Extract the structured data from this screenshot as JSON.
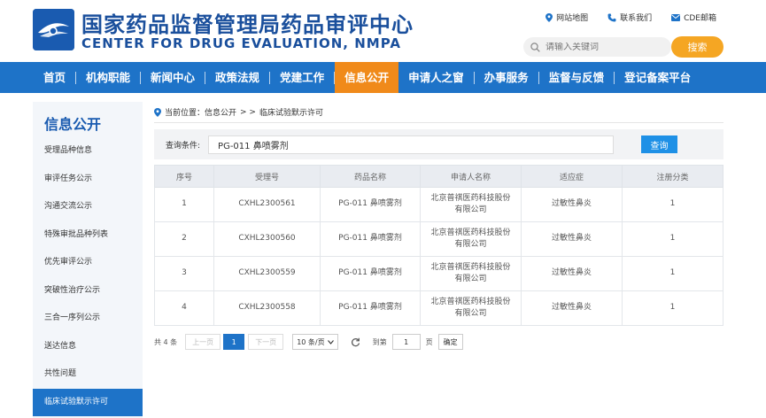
{
  "header": {
    "title_cn": "国家药品监督管理局药品审评中心",
    "title_en": "CENTER FOR DRUG EVALUATION, NMPA",
    "links": [
      {
        "label": "网站地图",
        "icon": "location-pin-icon"
      },
      {
        "label": "联系我们",
        "icon": "phone-icon"
      },
      {
        "label": "CDE邮箱",
        "icon": "mail-icon"
      }
    ],
    "search_placeholder": "请输入关键词",
    "search_button": "搜索"
  },
  "nav": {
    "items": [
      "首页",
      "机构职能",
      "新闻中心",
      "政策法规",
      "党建工作",
      "信息公开",
      "申请人之窗",
      "办事服务",
      "监督与反馈",
      "登记备案平台"
    ],
    "active": "信息公开"
  },
  "sidebar": {
    "title": "信息公开",
    "items": [
      "受理品种信息",
      "审评任务公示",
      "沟通交流公示",
      "特殊审批品种列表",
      "优先审评公示",
      "突破性治疗公示",
      "三合一序列公示",
      "送达信息",
      "共性问题",
      "临床试验默示许可"
    ],
    "active": "临床试验默示许可"
  },
  "breadcrumb": {
    "prefix": "当前位置：信息公开",
    "sep": "> >",
    "current": "临床试验默示许可"
  },
  "query": {
    "label": "查询条件:",
    "value": "PG-011 鼻喷雾剂",
    "button": "查询"
  },
  "table": {
    "headers": [
      "序号",
      "受理号",
      "药品名称",
      "申请人名称",
      "适应症",
      "注册分类"
    ],
    "rows": [
      [
        "1",
        "CXHL2300561",
        "PG-011 鼻喷雾剂",
        "北京普祺医药科技股份有限公司",
        "过敏性鼻炎",
        "1"
      ],
      [
        "2",
        "CXHL2300560",
        "PG-011 鼻喷雾剂",
        "北京普祺医药科技股份有限公司",
        "过敏性鼻炎",
        "1"
      ],
      [
        "3",
        "CXHL2300559",
        "PG-011 鼻喷雾剂",
        "北京普祺医药科技股份有限公司",
        "过敏性鼻炎",
        "1"
      ],
      [
        "4",
        "CXHL2300558",
        "PG-011 鼻喷雾剂",
        "北京普祺医药科技股份有限公司",
        "过敏性鼻炎",
        "1"
      ]
    ]
  },
  "pager": {
    "total": "共 4 条",
    "prev": "上一页",
    "current_page": "1",
    "next": "下一页",
    "page_size": "10 条/页",
    "goto_label": "到第",
    "goto_value": "1",
    "page_unit": "页",
    "confirm": "确定"
  },
  "colors": {
    "brand_blue": "#1e73c8",
    "title_blue": "#1a4f9c",
    "active_orange": "#f08a1a",
    "search_orange": "#f5a623"
  }
}
